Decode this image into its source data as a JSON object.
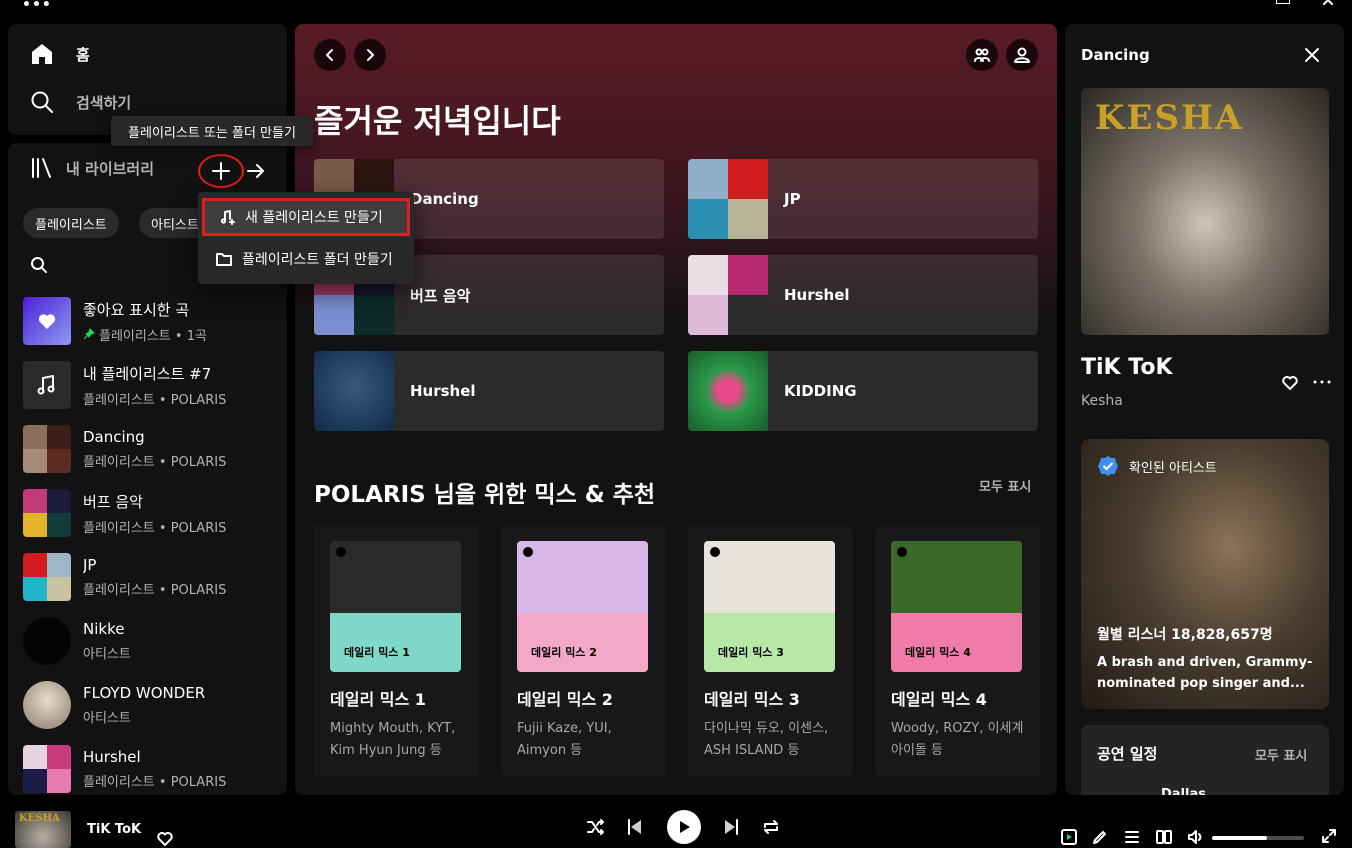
{
  "window": {
    "menu_glyph": "•••"
  },
  "nav": {
    "home_label": "홈",
    "search_label": "검색하기"
  },
  "library": {
    "title": "내 라이브러리",
    "tooltip": "플레이리스트 또는 폴더 만들기",
    "chips": [
      "플레이리스트",
      "아티스트"
    ],
    "items": [
      {
        "name": "좋아요 표시한 곡",
        "sub": "플레이리스트 • 1곡",
        "pinned": true
      },
      {
        "name": "내 플레이리스트 #7",
        "sub": "플레이리스트 • POLARIS"
      },
      {
        "name": "Dancing",
        "sub": "플레이리스트 • POLARIS"
      },
      {
        "name": "버프 음악",
        "sub": "플레이리스트 • POLARIS"
      },
      {
        "name": "JP",
        "sub": "플레이리스트 • POLARIS"
      },
      {
        "name": "Nikke",
        "sub": "아티스트"
      },
      {
        "name": "FLOYD WONDER",
        "sub": "아티스트"
      },
      {
        "name": "Hurshel",
        "sub": "플레이리스트 • POLARIS"
      }
    ]
  },
  "context_menu": {
    "new_playlist": "새 플레이리스트 만들기",
    "new_folder": "플레이리스트 폴더 만들기"
  },
  "main": {
    "greeting": "즐거운 저녁입니다",
    "tiles": [
      {
        "label": "Dancing"
      },
      {
        "label": "JP"
      },
      {
        "label": "버프 음악"
      },
      {
        "label": "Hurshel"
      },
      {
        "label": "Hurshel"
      },
      {
        "label": "KIDDING"
      }
    ],
    "section_title": "POLARIS 님을 위한 믹스 & 추천",
    "section_more": "모두 표시",
    "cards": [
      {
        "badge": "데일리 믹스 1",
        "title": "데일리 믹스 1",
        "desc": "Mighty Mouth, KYT, Kim Hyun Jung 등"
      },
      {
        "badge": "데일리 믹스 2",
        "title": "데일리 믹스 2",
        "desc": "Fujii Kaze, YUI, Aimyon 등"
      },
      {
        "badge": "데일리 믹스 3",
        "title": "데일리 믹스 3",
        "desc": "다이나믹 듀오, 이센스, ASH ISLAND 등"
      },
      {
        "badge": "데일리 믹스 4",
        "title": "데일리 믹스 4",
        "desc": "Woody, ROZY, 이세계 아이돌 등"
      }
    ]
  },
  "now_playing": {
    "panel_title": "Dancing",
    "cover_text": "KESHA",
    "song": "TiK ToK",
    "artist": "Kesha",
    "verified_label": "확인된 아티스트",
    "monthly_listeners": "월별 리스너 18,828,657명",
    "bio": "A brash and driven, Grammy-nominated pop singer and...",
    "tour_title": "공연 일정",
    "tour_more": "모두 표시",
    "tour_city": "Dallas"
  },
  "player": {
    "song": "TiK ToK",
    "cover_text": "KESHA",
    "volume": 0.6
  },
  "colors": {
    "accent_green": "#1ed760",
    "highlight_red": "#e31c1c",
    "main_gradient": "#5a1a26"
  }
}
